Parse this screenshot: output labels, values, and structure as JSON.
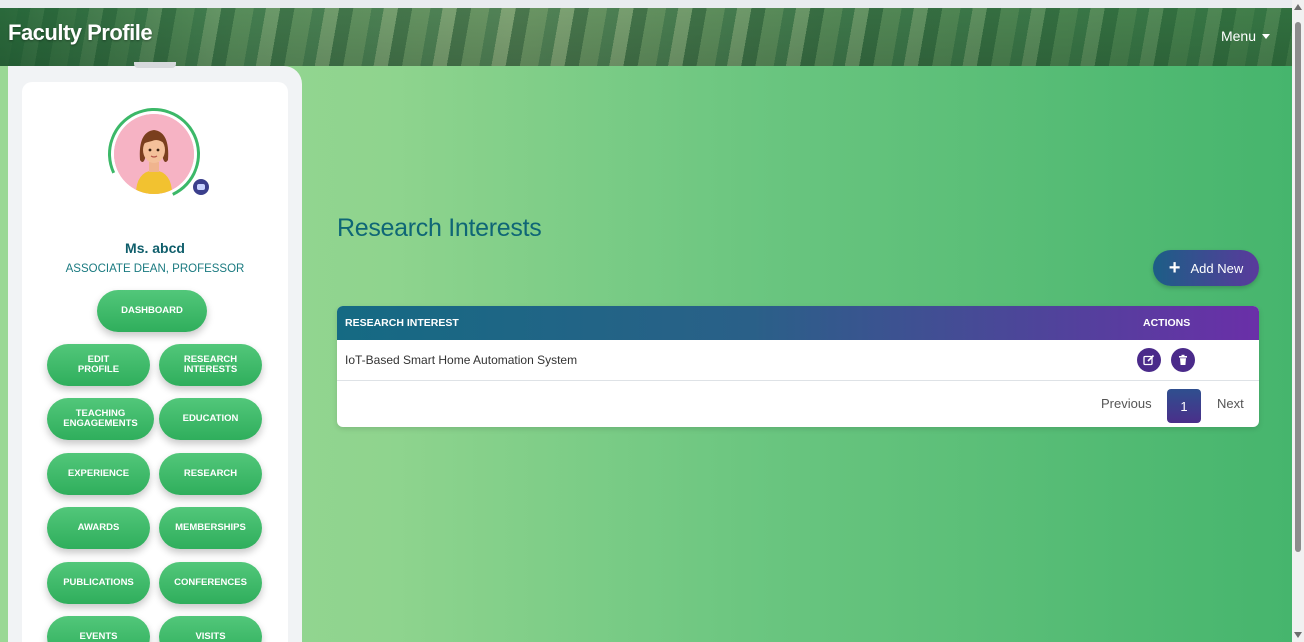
{
  "header": {
    "title": "Faculty Profile",
    "menu_label": "Menu"
  },
  "profile": {
    "name": "Ms. abcd",
    "role": "ASSOCIATE DEAN, PROFESSOR"
  },
  "sidebar": {
    "items": [
      {
        "label": "DASHBOARD"
      },
      {
        "label": "EDIT\nPROFILE"
      },
      {
        "label": "RESEARCH\nINTERESTS"
      },
      {
        "label": "TEACHING\nENGAGEMENTS"
      },
      {
        "label": "EDUCATION"
      },
      {
        "label": "EXPERIENCE"
      },
      {
        "label": "RESEARCH"
      },
      {
        "label": "AWARDS"
      },
      {
        "label": "MEMBERSHIPS"
      },
      {
        "label": "PUBLICATIONS"
      },
      {
        "label": "CONFERENCES"
      },
      {
        "label": "EVENTS"
      },
      {
        "label": "VISITS"
      }
    ]
  },
  "main": {
    "section_title": "Research Interests",
    "add_button_label": "Add New",
    "table": {
      "columns": [
        "RESEARCH INTEREST",
        "ACTIONS"
      ],
      "rows": [
        {
          "research_interest": "IoT-Based Smart Home Automation System"
        }
      ]
    },
    "pagination": {
      "previous_label": "Previous",
      "current_page": "1",
      "next_label": "Next"
    }
  },
  "colors": {
    "brand_teal": "#0f6676",
    "nav_green": "#2fae5c",
    "action_purple": "#4a2a8a"
  }
}
